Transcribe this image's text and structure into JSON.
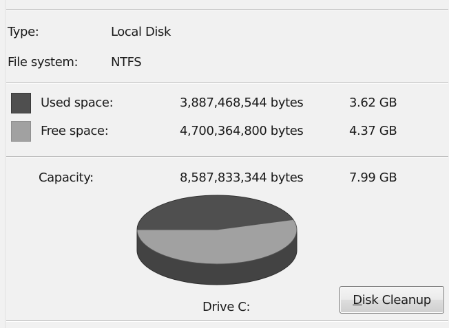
{
  "type_row": {
    "label": "Type:",
    "value": "Local Disk"
  },
  "filesystem_row": {
    "label": "File system:",
    "value": "NTFS"
  },
  "used_space": {
    "label": "Used space:",
    "bytes": "3,887,468,544 bytes",
    "size": "3.62 GB",
    "color": "#4f4f4f",
    "fraction": 0.4527
  },
  "free_space": {
    "label": "Free space:",
    "bytes": "4,700,364,800 bytes",
    "size": "4.37 GB",
    "color": "#a1a1a1",
    "fraction": 0.5473
  },
  "capacity": {
    "label": "Capacity:",
    "bytes": "8,587,833,344 bytes",
    "size": "7.99 GB"
  },
  "drive_label": "Drive C:",
  "disk_cleanup_button": {
    "accel_letter": "D",
    "label_rest": "isk Cleanup"
  }
}
